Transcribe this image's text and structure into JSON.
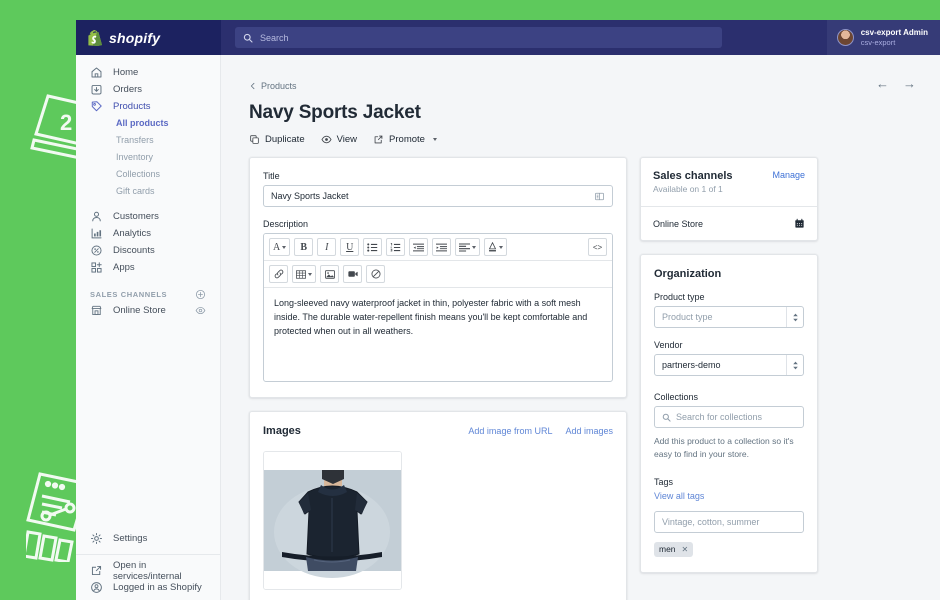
{
  "theme": {
    "backdrop_green": "#5ec95c",
    "topbar_navy": "#2b2f6e",
    "logo_navy": "#1c2260",
    "link_blue": "#5f86d6",
    "active_indigo": "#5c6ac4",
    "text_dark": "#212b36",
    "text_muted": "#919eab"
  },
  "topbar": {
    "brand": "shopify",
    "search": {
      "placeholder": "Search",
      "icon": "search-icon"
    },
    "user": {
      "name": "csv-export Admin",
      "store": "csv-export"
    }
  },
  "sidebar": {
    "items": [
      {
        "label": "Home",
        "icon": "home-icon"
      },
      {
        "label": "Orders",
        "icon": "orders-icon"
      },
      {
        "label": "Products",
        "icon": "products-tag-icon"
      },
      {
        "label": "Customers",
        "icon": "customer-icon"
      },
      {
        "label": "Analytics",
        "icon": "analytics-bars-icon"
      },
      {
        "label": "Discounts",
        "icon": "discount-percent-icon"
      },
      {
        "label": "Apps",
        "icon": "apps-grid-icon"
      }
    ],
    "product_subitems": [
      {
        "label": "All products",
        "active": true
      },
      {
        "label": "Transfers",
        "active": false
      },
      {
        "label": "Inventory",
        "active": false
      },
      {
        "label": "Collections",
        "active": false
      },
      {
        "label": "Gift cards",
        "active": false
      }
    ],
    "sales_channels": {
      "heading": "SALES CHANNELS",
      "add_icon": "plus-circle-icon",
      "items": [
        {
          "label": "Online Store",
          "icon": "storefront-icon",
          "trailing_icon": "eye-icon"
        }
      ]
    },
    "bottom": [
      {
        "label": "Settings",
        "icon": "gear-icon"
      },
      {
        "label": "Open in services/internal",
        "icon": "external-link-icon"
      },
      {
        "label": "Logged in as Shopify",
        "icon": "user-circle-icon"
      }
    ]
  },
  "page": {
    "breadcrumb": "Products",
    "breadcrumb_icon": "chevron-left-icon",
    "title": "Navy Sports Jacket",
    "actions": [
      {
        "label": "Duplicate",
        "icon": "duplicate-icon"
      },
      {
        "label": "View",
        "icon": "eye-icon"
      },
      {
        "label": "Promote",
        "icon": "external-link-icon",
        "has_caret": true
      }
    ],
    "nav_back_icon": "arrow-left-icon",
    "nav_forward_icon": "arrow-right-icon"
  },
  "product_form": {
    "title_label": "Title",
    "title_value": "Navy Sports Jacket",
    "title_trailing_icon": "translate-icon",
    "description_label": "Description",
    "description_value": "Long-sleeved navy waterproof jacket in thin, polyester fabric with a soft mesh inside. The durable water-repellent finish means you'll be kept comfortable and protected when out in all weathers.",
    "toolbar_row1": [
      {
        "name": "font-style-select",
        "glyph": "A",
        "caret": true
      },
      {
        "name": "bold-button",
        "glyph": "B",
        "caret": false
      },
      {
        "name": "italic-button",
        "glyph": "I",
        "caret": false
      },
      {
        "name": "underline-button",
        "glyph": "U",
        "caret": false
      },
      {
        "name": "bulleted-list-button",
        "glyph": "list-bullet-icon",
        "caret": false
      },
      {
        "name": "numbered-list-button",
        "glyph": "list-number-icon",
        "caret": false
      },
      {
        "name": "outdent-button",
        "glyph": "outdent-icon",
        "caret": false
      },
      {
        "name": "indent-button",
        "glyph": "indent-icon",
        "caret": false
      },
      {
        "name": "align-select",
        "glyph": "align-left-icon",
        "caret": true
      },
      {
        "name": "text-color-select",
        "glyph": "text-color-icon",
        "caret": true
      }
    ],
    "toolbar_code_button": {
      "name": "show-html-button",
      "glyph": "<>"
    },
    "toolbar_row2": [
      {
        "name": "insert-link-button",
        "glyph": "link-icon",
        "caret": false
      },
      {
        "name": "insert-table-button",
        "glyph": "table-icon",
        "caret": true
      },
      {
        "name": "insert-image-button",
        "glyph": "image-icon",
        "caret": false
      },
      {
        "name": "insert-video-button",
        "glyph": "video-icon",
        "caret": false
      },
      {
        "name": "clear-formatting-button",
        "glyph": "no-format-icon",
        "caret": false
      }
    ]
  },
  "images_card": {
    "title": "Images",
    "add_from_url": "Add image from URL",
    "add_images": "Add images",
    "thumbnail_alt": "navy-jacket-back-view"
  },
  "sales_channels_card": {
    "title": "Sales channels",
    "subtitle": "Available on 1 of 1",
    "manage_link": "Manage",
    "rows": [
      {
        "label": "Online Store",
        "trailing_icon": "calendar-icon"
      }
    ]
  },
  "organization_card": {
    "title": "Organization",
    "product_type_label": "Product type",
    "product_type_placeholder": "Product type",
    "product_type_value": "",
    "vendor_label": "Vendor",
    "vendor_value": "partners-demo",
    "collections_label": "Collections",
    "collections_placeholder": "Search for collections",
    "collections_search_icon": "search-icon",
    "collections_helper": "Add this product to a collection so it's easy to find in your store.",
    "tags_label": "Tags",
    "tags_view_all": "View all tags",
    "tags_placeholder": "Vintage, cotton, summer",
    "tags": [
      {
        "label": "men",
        "remove_icon": "close-icon"
      }
    ]
  },
  "decorations": [
    {
      "name": "laptop-illustration"
    },
    {
      "name": "analytics-illustration"
    },
    {
      "name": "shopping-cart-illustration"
    },
    {
      "name": "storefront-illustration"
    }
  ]
}
